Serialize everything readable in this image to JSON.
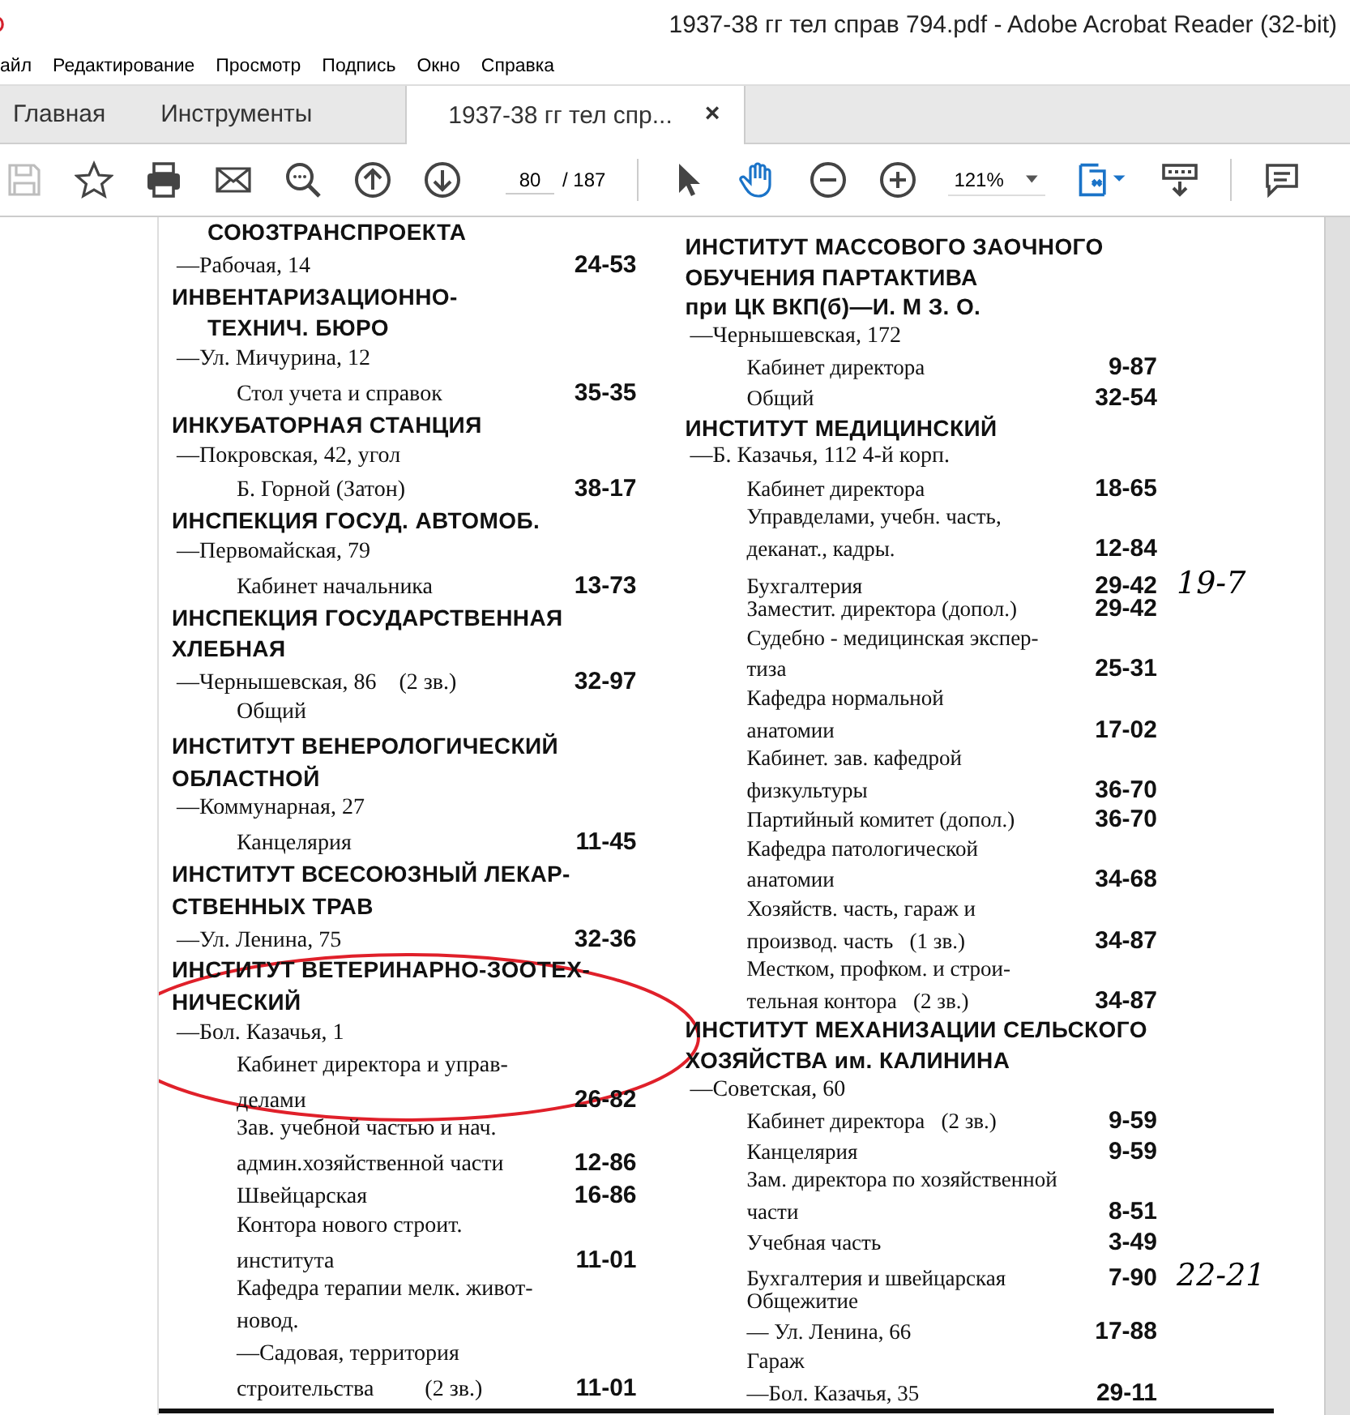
{
  "window": {
    "title": "1937-38 гг тел справ 794.pdf - Adobe Acrobat Reader (32-bit)"
  },
  "menu": [
    "айл",
    "Редактирование",
    "Просмотр",
    "Подпись",
    "Окно",
    "Справка"
  ],
  "tabs": [
    {
      "label": "Главная",
      "selected": false
    },
    {
      "label": "Инструменты",
      "selected": false
    },
    {
      "label": "1937-38 гг тел спр...",
      "selected": true,
      "close": "×"
    }
  ],
  "toolbar": {
    "save": {
      "disabled": true
    },
    "page_input": "80",
    "page_total": "/ 187",
    "hand_tool": {
      "selected": true
    },
    "zoom": "121%"
  },
  "document": {
    "markup_ellipse": true,
    "columns": [
      [
        {
          "kind": "heading-cont",
          "text": "СОЮЗТРАНСПРОЕКТА"
        },
        {
          "kind": "address",
          "text": "—Рабочая, 14",
          "phone": "24-53"
        },
        {
          "kind": "heading",
          "text": "ИНВЕНТАРИЗАЦИОННО-"
        },
        {
          "kind": "heading-cont",
          "text": "ТЕХНИЧ. БЮРО"
        },
        {
          "kind": "address",
          "text": "—Ул. Мичурина, 12"
        },
        {
          "kind": "entry",
          "text": "Стол учета и справок",
          "phone": "35-35"
        },
        {
          "kind": "heading",
          "text": "ИНКУБАТОРНАЯ СТАНЦИЯ"
        },
        {
          "kind": "address",
          "text": "—Покровская, 42, угол"
        },
        {
          "kind": "entry",
          "text": "Б. Горной (Затон)",
          "phone": "38-17"
        },
        {
          "kind": "heading",
          "text": "ИНСПЕКЦИЯ ГОСУД. АВТОМОБ."
        },
        {
          "kind": "address",
          "text": "—Первомайская, 79"
        },
        {
          "kind": "entry",
          "text": "Кабинет начальника",
          "phone": "13-73"
        },
        {
          "kind": "heading",
          "text": "ИНСПЕКЦИЯ ГОСУДАРСТВЕННАЯ"
        },
        {
          "kind": "heading",
          "text": "ХЛЕБНАЯ"
        },
        {
          "kind": "address",
          "text": "—Чернышевская, 86    (2 зв.)",
          "phone": "32-97"
        },
        {
          "kind": "entry",
          "text": "Общий"
        },
        {
          "kind": "heading",
          "text": "ИНСТИТУТ ВЕНЕРОЛОГИЧЕСКИЙ"
        },
        {
          "kind": "heading",
          "text": "ОБЛАСТНОЙ"
        },
        {
          "kind": "address",
          "text": "—Коммунарная, 27"
        },
        {
          "kind": "entry",
          "text": "Канцелярия",
          "phone": "11-45"
        },
        {
          "kind": "heading",
          "text": "ИНСТИТУТ ВСЕСОЮЗНЫЙ ЛЕКАР-"
        },
        {
          "kind": "heading",
          "text": "СТВЕННЫХ ТРАВ"
        },
        {
          "kind": "address",
          "text": "—Ул. Ленина, 75",
          "phone": "32-36"
        },
        {
          "kind": "heading",
          "text": "ИНСТИТУТ ВЕТЕРИНАРНО-ЗООТЕХ-"
        },
        {
          "kind": "heading",
          "text": "НИЧЕСКИЙ"
        },
        {
          "kind": "address",
          "text": "—Бол. Казачья, 1"
        },
        {
          "kind": "entry",
          "text": "Кабинет директора и управ-"
        },
        {
          "kind": "entry",
          "text": "делами",
          "phone": "26-82"
        },
        {
          "kind": "entry",
          "text": "Зав. учебной частью и нач."
        },
        {
          "kind": "entry",
          "text": "админ.хозяйственной части",
          "phone": "12-86"
        },
        {
          "kind": "entry",
          "text": "Швейцарская",
          "phone": "16-86"
        },
        {
          "kind": "entry",
          "text": "Контора нового строит."
        },
        {
          "kind": "entry",
          "text": "института",
          "phone": "11-01"
        },
        {
          "kind": "entry",
          "text": "Кафедра терапии мелк. живот-"
        },
        {
          "kind": "entry",
          "text": "новод."
        },
        {
          "kind": "entry",
          "text": "—Садовая, территория"
        },
        {
          "kind": "entry",
          "text": "строительства         (2 зв.)",
          "phone": "11-01"
        }
      ],
      [
        {
          "kind": "heading",
          "text": "ИНСТИТУТ МАССОВОГО ЗАОЧНОГО"
        },
        {
          "kind": "heading",
          "text": "ОБУЧЕНИЯ ПАРТАКТИВА"
        },
        {
          "kind": "heading",
          "text": "при ЦК ВКП(б)—И. М З. О."
        },
        {
          "kind": "address",
          "text": "—Чернышевская, 172"
        },
        {
          "kind": "entry",
          "text": "Кабинет директора",
          "phone": "9-87"
        },
        {
          "kind": "entry",
          "text": "Общий",
          "phone": "32-54"
        },
        {
          "kind": "heading",
          "text": "ИНСТИТУТ МЕДИЦИНСКИЙ"
        },
        {
          "kind": "address",
          "text": "—Б. Казачья, 112 4-й корп."
        },
        {
          "kind": "entry",
          "text": "Кабинет директора",
          "phone": "18-65"
        },
        {
          "kind": "entry",
          "text": "Управделами, учебн. часть,"
        },
        {
          "kind": "entry",
          "text": "деканат., кадры.",
          "phone": "12-84"
        },
        {
          "kind": "entry",
          "text": "Бухгалтерия",
          "phone": "29-42",
          "note": "19-7"
        },
        {
          "kind": "entry",
          "text": "Заместит. директора (допол.)",
          "phone": "29-42"
        },
        {
          "kind": "entry",
          "text": "Судебно - медицинская экспер-"
        },
        {
          "kind": "entry",
          "text": "тиза",
          "phone": "25-31"
        },
        {
          "kind": "entry",
          "text": "Кафедра нормальной"
        },
        {
          "kind": "entry",
          "text": "анатомии",
          "phone": "17-02"
        },
        {
          "kind": "entry",
          "text": "Кабинет. зав. кафедрой"
        },
        {
          "kind": "entry",
          "text": "физкультуры",
          "phone": "36-70"
        },
        {
          "kind": "entry",
          "text": "Партийный комитет (допол.)",
          "phone": "36-70"
        },
        {
          "kind": "entry",
          "text": "Кафедра патологической"
        },
        {
          "kind": "entry",
          "text": "анатомии",
          "phone": "34-68"
        },
        {
          "kind": "entry",
          "text": "Хозяйств. часть, гараж и"
        },
        {
          "kind": "entry",
          "text": "производ. часть   (1 зв.)",
          "phone": "34-87"
        },
        {
          "kind": "entry",
          "text": "Местком, профком. и строи-"
        },
        {
          "kind": "entry",
          "text": "тельная контора   (2 зв.)",
          "phone": "34-87"
        },
        {
          "kind": "heading",
          "text": "ИНСТИТУТ МЕХАНИЗАЦИИ СЕЛЬСКОГО"
        },
        {
          "kind": "heading",
          "text": "ХОЗЯЙСТВА им. КАЛИНИНА"
        },
        {
          "kind": "address",
          "text": "—Советская, 60"
        },
        {
          "kind": "entry",
          "text": "Кабинет директора   (2 зв.)",
          "phone": "9-59"
        },
        {
          "kind": "entry",
          "text": "Канцелярия",
          "phone": "9-59"
        },
        {
          "kind": "entry",
          "text": "Зам. директора по хозяйственной"
        },
        {
          "kind": "entry",
          "text": "части",
          "phone": "8-51"
        },
        {
          "kind": "entry",
          "text": "Учебная часть",
          "phone": "3-49"
        },
        {
          "kind": "entry",
          "text": "Бухгалтерия и швейцарская",
          "phone": "7-90",
          "note": "22-21"
        },
        {
          "kind": "entry",
          "text": "Общежитие"
        },
        {
          "kind": "entry",
          "text": "— Ул. Ленина, 66",
          "phone": "17-88"
        },
        {
          "kind": "entry",
          "text": "Гараж"
        },
        {
          "kind": "entry",
          "text": "—Бол. Казачья, 35",
          "phone": "29-11"
        }
      ]
    ]
  }
}
